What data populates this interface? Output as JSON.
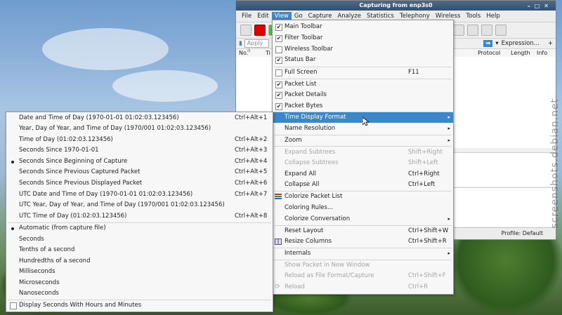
{
  "window": {
    "title": "Capturing from enp3s0"
  },
  "menubar": [
    "File",
    "Edit",
    "View",
    "Go",
    "Capture",
    "Analyze",
    "Statistics",
    "Telephony",
    "Wireless",
    "Tools",
    "Help"
  ],
  "filter": {
    "placeholder": "Apply a",
    "expression_label": "Expression...",
    "add": "+"
  },
  "columns": {
    "no": "No.",
    "time": "Ti",
    "protocol": "Protocol",
    "length": "Length",
    "info": "Info"
  },
  "status": {
    "profile": "Profile: Default"
  },
  "view_menu": {
    "main_toolbar": "Main Toolbar",
    "filter_toolbar": "Filter Toolbar",
    "wireless_toolbar": "Wireless Toolbar",
    "status_bar": "Status Bar",
    "full_screen": "Full Screen",
    "full_screen_sc": "F11",
    "packet_list": "Packet List",
    "packet_details": "Packet Details",
    "packet_bytes": "Packet Bytes",
    "time_display_format": "Time Display Format",
    "name_resolution": "Name Resolution",
    "zoom": "Zoom",
    "expand_subtrees": "Expand Subtrees",
    "expand_subtrees_sc": "Shift+Right",
    "collapse_subtrees": "Collapse Subtrees",
    "collapse_subtrees_sc": "Shift+Left",
    "expand_all": "Expand All",
    "expand_all_sc": "Ctrl+Right",
    "collapse_all": "Collapse All",
    "collapse_all_sc": "Ctrl+Left",
    "colorize_packet_list": "Colorize Packet List",
    "coloring_rules": "Coloring Rules...",
    "colorize_conversation": "Colorize Conversation",
    "reset_layout": "Reset Layout",
    "reset_layout_sc": "Ctrl+Shift+W",
    "resize_columns": "Resize Columns",
    "resize_columns_sc": "Ctrl+Shift+R",
    "internals": "Internals",
    "show_packet_new_window": "Show Packet in New Window",
    "reload_file_format": "Reload as File Format/Capture",
    "reload_file_format_sc": "Ctrl+Shift+F",
    "reload": "Reload",
    "reload_sc": "Ctrl+R"
  },
  "time_menu": {
    "date_time_of_day": "Date and Time of Day (1970-01-01 01:02:03.123456)",
    "date_time_of_day_sc": "Ctrl+Alt+1",
    "year_doy_time": "Year, Day of Year, and Time of Day (1970/001 01:02:03.123456)",
    "time_of_day": "Time of Day (01:02:03.123456)",
    "time_of_day_sc": "Ctrl+Alt+2",
    "seconds_since_epoch": "Seconds Since 1970-01-01",
    "seconds_since_epoch_sc": "Ctrl+Alt+3",
    "seconds_since_capture": "Seconds Since Beginning of Capture",
    "seconds_since_capture_sc": "Ctrl+Alt+4",
    "seconds_since_prev_captured": "Seconds Since Previous Captured Packet",
    "seconds_since_prev_captured_sc": "Ctrl+Alt+5",
    "seconds_since_prev_displayed": "Seconds Since Previous Displayed Packet",
    "seconds_since_prev_displayed_sc": "Ctrl+Alt+6",
    "utc_date_time": "UTC Date and Time of Day (1970-01-01 01:02:03.123456)",
    "utc_date_time_sc": "Ctrl+Alt+7",
    "utc_year_doy_time": "UTC Year, Day of Year, and Time of Day (1970/001 01:02:03.123456)",
    "utc_time_of_day": "UTC Time of Day (01:02:03.123456)",
    "utc_time_of_day_sc": "Ctrl+Alt+8",
    "automatic": "Automatic (from capture file)",
    "seconds": "Seconds",
    "tenths": "Tenths of a second",
    "hundredths": "Hundredths of a second",
    "milliseconds": "Milliseconds",
    "microseconds": "Microseconds",
    "nanoseconds": "Nanoseconds",
    "display_hours_minutes": "Display Seconds With Hours and Minutes"
  },
  "watermark": "screenshots.debian.net"
}
